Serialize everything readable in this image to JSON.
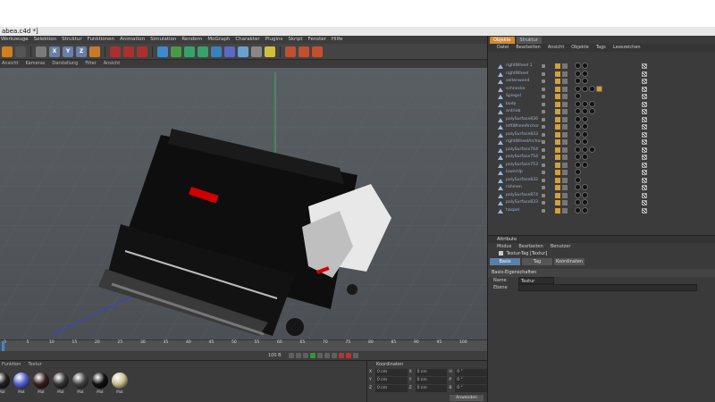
{
  "window": {
    "title": "abea.c4d *]"
  },
  "menubar": [
    "Werkzeuge",
    "Selektion",
    "Struktur",
    "Funktionen",
    "Animation",
    "Simulation",
    "Rendern",
    "MoGraph",
    "Charakter",
    "Plugins",
    "Skript",
    "Fenster",
    "Hilfe"
  ],
  "toolbar_icons": [
    {
      "icon": "undo-icon",
      "color": "#d08020"
    },
    {
      "icon": "live-select-icon",
      "color": "#555"
    },
    {
      "icon": "move-icon",
      "color": "#7a7a7a"
    },
    {
      "icon": "x-axis-icon",
      "glyph": "X",
      "color": "#6a7fa8"
    },
    {
      "icon": "y-axis-icon",
      "glyph": "Y",
      "color": "#6a7fa8"
    },
    {
      "icon": "z-axis-icon",
      "glyph": "Z",
      "color": "#6a7fa8"
    },
    {
      "icon": "coordinate-system-icon",
      "color": "#c87a2a"
    },
    {
      "icon": "render-view-icon",
      "color": "#aa3030"
    },
    {
      "icon": "render-picture-viewer-icon",
      "color": "#aa3030"
    },
    {
      "icon": "render-settings-icon",
      "color": "#aa3030"
    },
    {
      "icon": "cube-icon",
      "color": "#3a8ccc"
    },
    {
      "icon": "pen-icon",
      "color": "#4a9a4a"
    },
    {
      "icon": "subdivision-icon",
      "color": "#3aa06a"
    },
    {
      "icon": "array-icon",
      "color": "#3aa06a"
    },
    {
      "icon": "deformer-icon",
      "color": "#3a80c0"
    },
    {
      "icon": "scene-icon",
      "color": "#5a6ac0"
    },
    {
      "icon": "environment-icon",
      "color": "#6aa0d0"
    },
    {
      "icon": "camera-icon",
      "color": "#888"
    },
    {
      "icon": "light-icon",
      "color": "#d0c040"
    },
    {
      "icon": "snap-icon",
      "color": "#c05030"
    },
    {
      "icon": "workplane-icon",
      "color": "#c05030"
    },
    {
      "icon": "layout-icon",
      "color": "#c05030"
    }
  ],
  "viewport": {
    "menu": [
      "Ansicht",
      "Kameras",
      "Darstellung",
      "Filter",
      "Ansicht"
    ]
  },
  "timeline": {
    "ticks": [
      "0",
      "5",
      "10",
      "15",
      "20",
      "25",
      "30",
      "35",
      "40",
      "45",
      "50",
      "55",
      "60",
      "65",
      "70",
      "75",
      "80",
      "85",
      "90",
      "95",
      "100"
    ],
    "frame_readout": "100 B"
  },
  "materials": {
    "menu": [
      "Funktion",
      "Textur"
    ],
    "items": [
      {
        "label": "Mat",
        "color": "#222"
      },
      {
        "label": "Mat",
        "color": "#5560d0"
      },
      {
        "label": "Mat",
        "color": "#3a2020"
      },
      {
        "label": "Mat",
        "color": "#333"
      },
      {
        "label": "Mat",
        "color": "#444"
      },
      {
        "label": "Mat",
        "color": "#111"
      },
      {
        "label": "Mat",
        "color": "#c8c090"
      }
    ]
  },
  "coordinates": {
    "title": "Koordinaten",
    "rows": [
      {
        "a": "X",
        "av": "0 cm",
        "b": "X",
        "bv": "0 cm",
        "c": "H",
        "cv": "0 °"
      },
      {
        "a": "Y",
        "av": "0 cm",
        "b": "Y",
        "bv": "0 cm",
        "c": "P",
        "cv": "0 °"
      },
      {
        "a": "Z",
        "av": "0 cm",
        "b": "Z",
        "bv": "0 cm",
        "c": "B",
        "cv": "0 °"
      }
    ],
    "apply_label": "Anwenden"
  },
  "objects_panel": {
    "tabs": [
      "Objekte",
      "Struktur"
    ],
    "menu": [
      "Datei",
      "Bearbeiten",
      "Ansicht",
      "Objekte",
      "Tags",
      "Lesezeichen"
    ],
    "items": [
      {
        "name": "rightWheel 1",
        "tags": [
          "black",
          "chk",
          "black"
        ]
      },
      {
        "name": "rightWheel",
        "tags": [
          "black",
          "chk",
          "black"
        ]
      },
      {
        "name": "seitenwand",
        "tags": [
          "black",
          "chk",
          "black"
        ]
      },
      {
        "name": "schnecke",
        "tags": [
          "black",
          "chk",
          "black",
          "black",
          "gold"
        ]
      },
      {
        "name": "Spiegel",
        "tags": [
          "black",
          "chk"
        ]
      },
      {
        "name": "body",
        "tags": [
          "black",
          "chk",
          "black",
          "black"
        ]
      },
      {
        "name": "antrieb",
        "tags": [
          "black",
          "chk",
          "black",
          "black"
        ]
      },
      {
        "name": "polySurface836",
        "tags": [
          "black",
          "chk",
          "black"
        ]
      },
      {
        "name": "leftWheelArchor",
        "tags": [
          "black",
          "chk",
          "black"
        ]
      },
      {
        "name": "polySurface833",
        "tags": [
          "black",
          "chk",
          "black"
        ]
      },
      {
        "name": "rightWheelArchor",
        "tags": [
          "black",
          "chk",
          "black"
        ]
      },
      {
        "name": "polySurface764",
        "tags": [
          "black",
          "chk",
          "black",
          "black"
        ]
      },
      {
        "name": "polySurface754",
        "tags": [
          "black",
          "chk",
          "black"
        ]
      },
      {
        "name": "polySurface753",
        "tags": [
          "black",
          "chk",
          "black"
        ]
      },
      {
        "name": "lowerUp",
        "tags": [
          "black",
          "chk"
        ]
      },
      {
        "name": "polySurface832",
        "tags": [
          "black",
          "chk"
        ]
      },
      {
        "name": "rahmen",
        "tags": [
          "black",
          "chk",
          "black"
        ]
      },
      {
        "name": "polySurface874",
        "tags": [
          "black",
          "chk",
          "black"
        ]
      },
      {
        "name": "polySurface833",
        "tags": [
          "black",
          "chk",
          "black"
        ]
      },
      {
        "name": "haspel",
        "tags": [
          "black",
          "chk",
          "black"
        ]
      }
    ]
  },
  "attributes": {
    "header": "Attribute",
    "menu": [
      "Modus",
      "Bearbeiten",
      "Benutzer"
    ],
    "title": "Textur-Tag [Textur]",
    "tabs": [
      "Basis",
      "Tag",
      "Koordinaten"
    ],
    "section": "Basis-Eigenschaften",
    "fields": [
      {
        "label": "Name",
        "value": "Textur"
      },
      {
        "label": "Ebene",
        "value": ""
      }
    ]
  },
  "colors": {
    "accent": "#5b7ea8",
    "object_text": "#9fb3d0",
    "viewport_bg": "#555a5f"
  }
}
